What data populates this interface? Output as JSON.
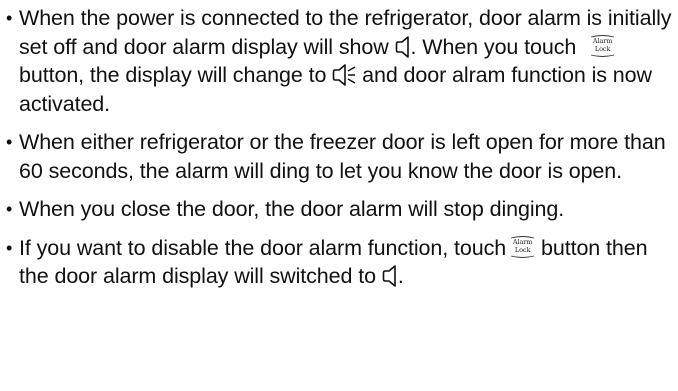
{
  "document": {
    "paragraphs": [
      {
        "segments": [
          "When the power is connected to the refrigerator, door alarm is initially set off and door alarm display will show",
          ". When you touch",
          "button, the display will change to",
          "and door alram function is now activated."
        ]
      },
      {
        "segments": [
          "When either refrigerator or the freezer door is left open for more than 60 seconds, the alarm will ding to let you know the door is open."
        ]
      },
      {
        "segments": [
          "When you close the door, the door alarm will stop dinging."
        ]
      },
      {
        "segments": [
          "If you want to disable the door alarm function, touch",
          "button then the door alarm display will switched to",
          "."
        ]
      }
    ],
    "bullet": "•",
    "button_label": {
      "line1": "Alarm",
      "line2": "Lock"
    },
    "icons": {
      "door_alarm_off": "bell-outline-icon",
      "door_alarm_on": "bell-ringing-icon",
      "alarm_lock_button": "alarm-lock-button-icon"
    }
  }
}
